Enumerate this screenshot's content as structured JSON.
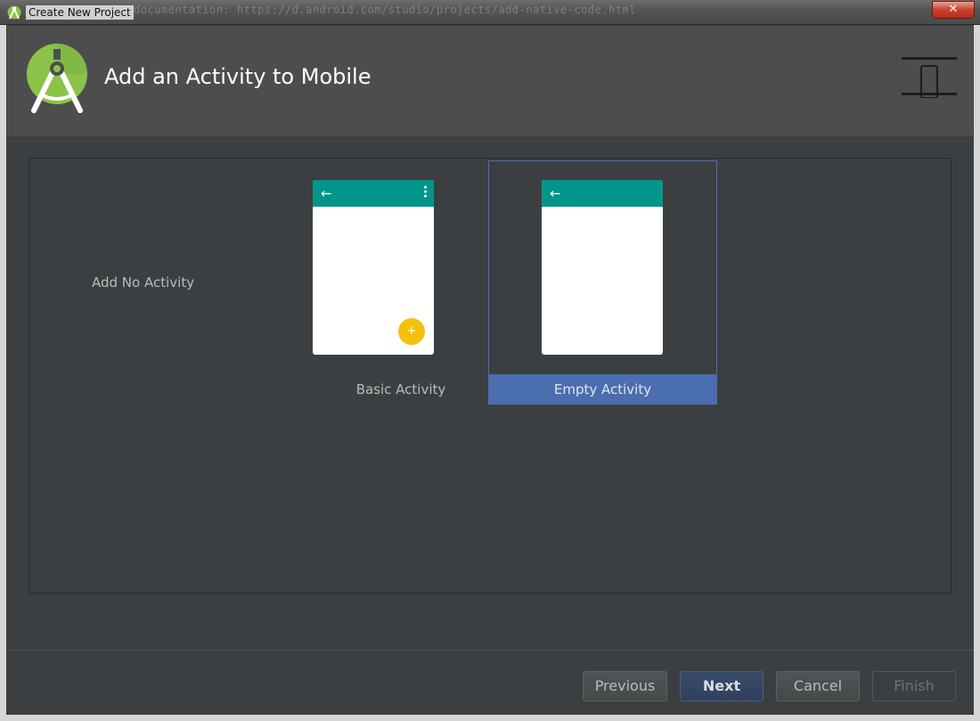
{
  "window": {
    "title": "Create New Project",
    "background_text": "documentation: https://d.android.com/studio/projects/add-native-code.html",
    "close_label": "✕"
  },
  "header": {
    "title": "Add an Activity to Mobile",
    "logo_icon": "android-studio-icon",
    "device_icon": "phone-device-icon"
  },
  "gallery": {
    "items": [
      {
        "label": "Add No Activity",
        "selected": false
      },
      {
        "label": "Basic Activity",
        "selected": false
      },
      {
        "label": "Empty Activity",
        "selected": true
      }
    ]
  },
  "footer": {
    "previous_label": "Previous",
    "next_label": "Next",
    "cancel_label": "Cancel",
    "finish_label": "Finish"
  },
  "colors": {
    "accent": "#4b6eaf",
    "toolbar": "#00978a",
    "fab": "#f5c10d",
    "background": "#3c3f41"
  }
}
